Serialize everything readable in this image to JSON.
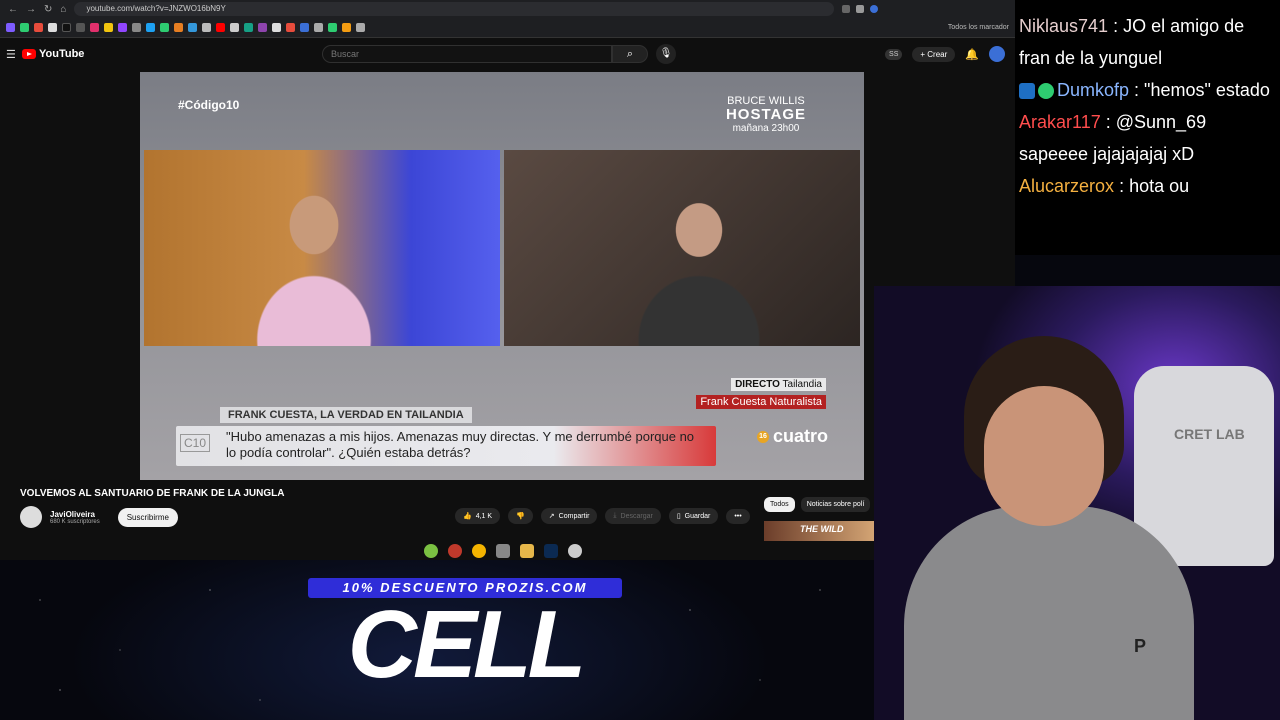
{
  "browser": {
    "url": "youtube.com/watch?v=JNZWO16bN9Y",
    "bookmarks_label": "Todos los marcador"
  },
  "youtube": {
    "logo_text": "YouTube",
    "search_placeholder": "Buscar",
    "ss_badge": "SS",
    "create_label": "Crear"
  },
  "video": {
    "hashtag": "#Código10",
    "promo": {
      "line1": "BRUCE WILLIS",
      "line2": "HOSTAGE",
      "line3": "mañana 23h00"
    },
    "live_label": "DIRECTO",
    "live_location": "Tailandia",
    "guest_name": "Frank Cuesta",
    "guest_role": "Naturalista",
    "headline": "FRANK CUESTA, LA VERDAD EN TAILANDIA",
    "program_logo": "C10",
    "quote": "\"Hubo amenazas a mis hijos. Amenazas muy directas. Y me derrumbé porque no lo podía controlar\". ¿Quién estaba detrás?",
    "channel_logo": "cuatro",
    "age_rating": "16"
  },
  "meta": {
    "title": "VOLVEMOS AL SANTUARIO DE FRANK DE LA JUNGLA",
    "channel": "JaviOliveira",
    "subscribers": "680 K suscriptores",
    "subscribe_label": "Suscribirme",
    "likes": "4,1 K",
    "share_label": "Compartir",
    "download_label": "Descargar",
    "save_label": "Guardar"
  },
  "chips": {
    "all": "Todos",
    "news": "Noticias sobre polí"
  },
  "thumb_text": "THE WILD",
  "overlay": {
    "promo_code": "10% DESCUENTO PROZIS.COM",
    "big_text": "CELL"
  },
  "chat": [
    {
      "user": "Niklaus741",
      "text": ": JO el amigo de fran de la yunguel"
    },
    {
      "user": "Dumkofp",
      "text": ": \"hemos\" estado"
    },
    {
      "user": "Arakar117",
      "text": ": @Sunn_69 sapeeee jajajajajaj xD"
    },
    {
      "user": "Alucarzerox",
      "text": ": hota ou"
    }
  ],
  "cam": {
    "chair_logo": "CRET LAB",
    "hoodie_badge": "P"
  },
  "colors": {
    "brand_red": "#ff0000",
    "prozis_blue": "#2f2dd8",
    "chat_blue": "#8ab6ff",
    "chat_red": "#ff4d4d",
    "chat_orange": "#f4b040"
  }
}
